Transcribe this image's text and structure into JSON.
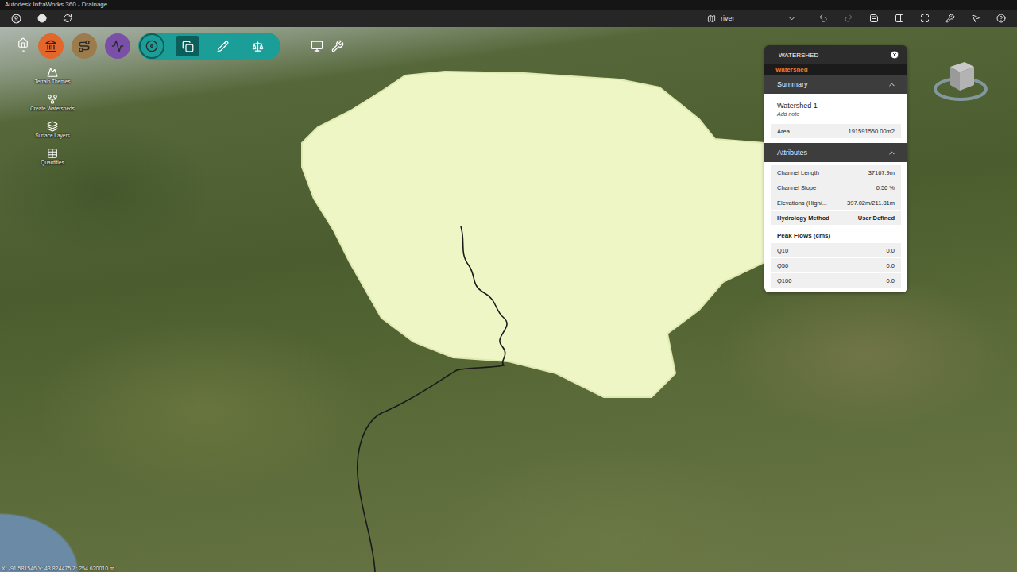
{
  "window": {
    "title": "Autodesk InfraWorks 360 - Drainage"
  },
  "top_bar": {
    "view_selector": "river"
  },
  "toolbar": {
    "modules": [
      {
        "color": "#e3662b",
        "selected": false
      },
      {
        "color": "#9c7b4c",
        "selected": false
      },
      {
        "color": "#7a4fa8",
        "selected": false
      },
      {
        "color": "#1a9e97",
        "selected": true
      }
    ],
    "module_tools": [
      {
        "selected": true
      },
      {
        "selected": false
      },
      {
        "selected": false
      }
    ]
  },
  "side_tools": [
    {
      "label": "Terrain Themes"
    },
    {
      "label": "Create Watersheds"
    },
    {
      "label": "Surface Layers"
    },
    {
      "label": "Quantities"
    }
  ],
  "panel": {
    "title": "WATERSHED",
    "tab": "Watershed",
    "summary": {
      "title": "Summary",
      "expanded": true,
      "name": "Watershed 1",
      "note_placeholder": "Add note",
      "rows": [
        {
          "label": "Area",
          "value": "191591550.00m2"
        }
      ]
    },
    "attributes": {
      "title": "Attributes",
      "expanded": true,
      "rows": [
        {
          "label": "Channel Length",
          "value": "37167.9m",
          "bold": false
        },
        {
          "label": "Channel Slope",
          "value": "0.50 %",
          "bold": false
        },
        {
          "label": "Elevations (High/...",
          "value": "397.02m/211.81m",
          "bold": false
        },
        {
          "label": "Hydrology Method",
          "value": "User Defined",
          "bold": true
        }
      ],
      "peak_flows": {
        "title": "Peak Flows (cms)",
        "rows": [
          {
            "label": "Q10",
            "value": "0.0"
          },
          {
            "label": "Q50",
            "value": "0.0"
          },
          {
            "label": "Q100",
            "value": "0.0"
          }
        ]
      }
    }
  },
  "status_bar": {
    "coordinates": "X: -91.581546 Y: 43.824475 Z: 254.620010 m"
  }
}
